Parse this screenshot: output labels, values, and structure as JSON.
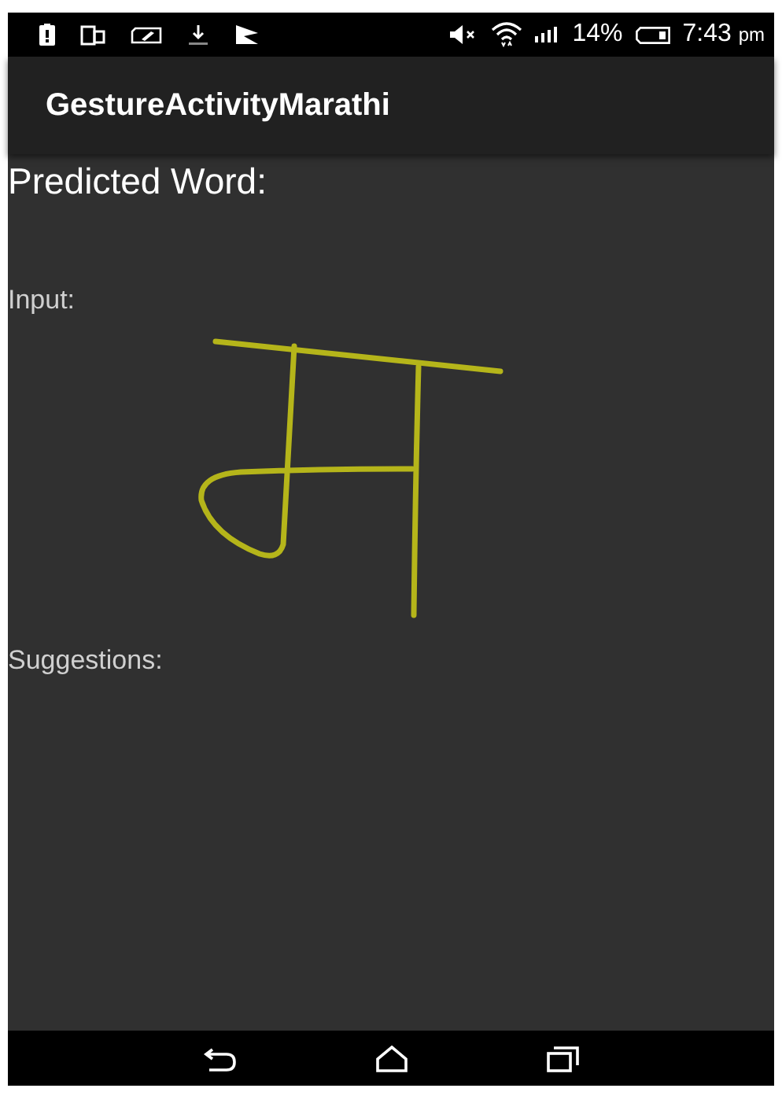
{
  "status_bar": {
    "battery_percent": "14%",
    "time": "7:43",
    "time_suffix": "pm"
  },
  "app_bar": {
    "title": "GestureActivityMarathi"
  },
  "predicted_word": {
    "label": "Predicted Word:"
  },
  "input": {
    "label": "Input:"
  },
  "suggestions": {
    "label": "Suggestions:"
  }
}
